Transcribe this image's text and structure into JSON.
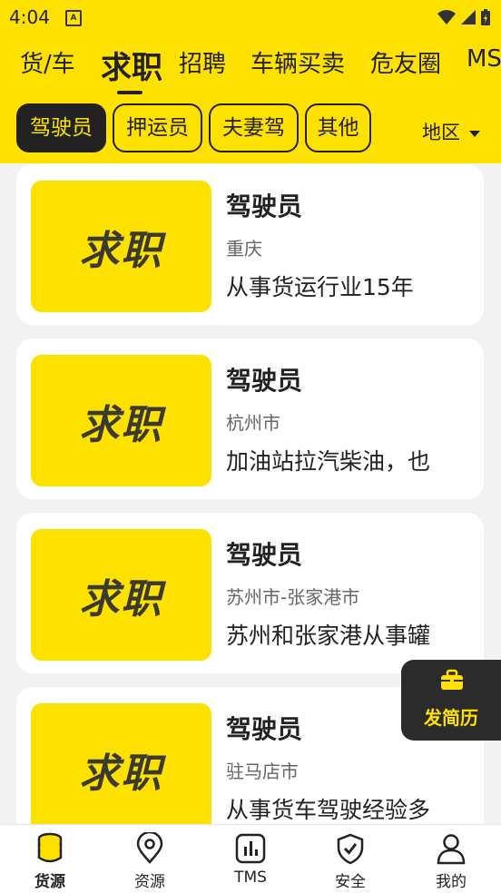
{
  "status_bar": {
    "time": "4:04",
    "notification_badge": "A"
  },
  "tabs": [
    {
      "label": "货/车",
      "active": false
    },
    {
      "label": "求职",
      "active": true
    },
    {
      "label": "招聘",
      "active": false
    },
    {
      "label": "车辆买卖",
      "active": false
    },
    {
      "label": "危友圈",
      "active": false
    },
    {
      "label": "MS",
      "active": false
    }
  ],
  "filters": {
    "chips": [
      {
        "label": "驾驶员",
        "active": true
      },
      {
        "label": "押运员",
        "active": false
      },
      {
        "label": "夫妻驾",
        "active": false
      },
      {
        "label": "其他",
        "active": false
      }
    ],
    "region_label": "地区"
  },
  "listings": [
    {
      "thumb_text": "求职",
      "title": "驾驶员",
      "location": "重庆",
      "description": "从事货运行业15年"
    },
    {
      "thumb_text": "求职",
      "title": "驾驶员",
      "location": "杭州市",
      "description": "加油站拉汽柴油，也"
    },
    {
      "thumb_text": "求职",
      "title": "驾驶员",
      "location": "苏州市-张家港市",
      "description": "苏州和张家港从事罐"
    },
    {
      "thumb_text": "求职",
      "title": "驾驶员",
      "location": "驻马店市",
      "description": "从事货车驾驶经验多"
    }
  ],
  "fab": {
    "label": "发简历",
    "icon": "briefcase-icon"
  },
  "bottom_nav": [
    {
      "label": "货源",
      "icon": "coins-icon",
      "active": true
    },
    {
      "label": "资源",
      "icon": "location-pin-icon",
      "active": false
    },
    {
      "label": "TMS",
      "icon": "bar-chart-icon",
      "active": false
    },
    {
      "label": "安全",
      "icon": "shield-check-icon",
      "active": false
    },
    {
      "label": "我的",
      "icon": "user-icon",
      "active": false
    }
  ],
  "colors": {
    "brand_yellow": "#FFE100",
    "dark": "#222222",
    "background": "#F2F2F2"
  }
}
